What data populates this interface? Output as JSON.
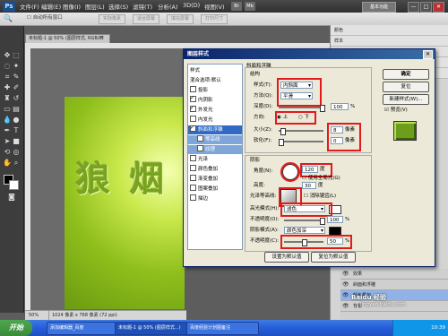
{
  "app": {
    "logo": "Ps",
    "workspace_button": "基本功能",
    "min": "—",
    "max": "□",
    "close": "✕"
  },
  "menu": [
    "文件(F)",
    "编辑(E)",
    "图像(I)",
    "图层(L)",
    "选择(S)",
    "滤镜(T)",
    "分析(A)",
    "3D(D)",
    "视图(V)"
  ],
  "menu_badges": [
    "Br",
    "Mb"
  ],
  "zoom_select": "50%",
  "options": {
    "checkbox_label": "自动所有窗口",
    "btn1": "实际像素",
    "btn2": "适合屏幕",
    "btn3": "填充屏幕",
    "btn4": "打印尺寸"
  },
  "doc_tab": {
    "title": "未标题-1 @ 50% (图层样式, RGB/8)",
    "close": "×"
  },
  "status": {
    "zoom": "50%",
    "info": "1024 像素 x 768 像素 (72 ppi)"
  },
  "canvas_text": [
    "狼",
    "烟"
  ],
  "taskbar": {
    "start": "开始",
    "tasks": [
      "添加编辑器_百度",
      "未标题-1 @ 50% (图层样式...)",
      "百度经验计划图备注"
    ],
    "tray_time": "10:39"
  },
  "watermark": {
    "line1": "Baidu 经验",
    "line2": "jingyan.baidu.com"
  },
  "right_panel": {
    "rows": [
      "颜色",
      "样本",
      "调整",
      "蒙版",
      "样式"
    ],
    "layers": [
      {
        "name": "效果",
        "selected": false
      },
      {
        "name": "斜面和浮雕",
        "selected": false
      },
      {
        "name": "颜色叠加",
        "selected": true
      },
      {
        "name": "背景",
        "selected": false
      }
    ]
  },
  "dialog": {
    "title": "图层样式",
    "close": "✕",
    "style_list": [
      {
        "label": "样式",
        "checkbox": false,
        "checked": false,
        "state": "header"
      },
      {
        "label": "混合选项:默认",
        "checkbox": false,
        "checked": false,
        "state": "normal"
      },
      {
        "label": "投影",
        "checkbox": true,
        "checked": false,
        "state": "normal"
      },
      {
        "label": "内阴影",
        "checkbox": true,
        "checked": true,
        "state": "normal"
      },
      {
        "label": "外发光",
        "checkbox": true,
        "checked": true,
        "state": "normal"
      },
      {
        "label": "内发光",
        "checkbox": true,
        "checked": false,
        "state": "normal"
      },
      {
        "label": "斜面和浮雕",
        "checkbox": true,
        "checked": true,
        "state": "selected"
      },
      {
        "label": "等高线",
        "checkbox": true,
        "checked": false,
        "state": "sub"
      },
      {
        "label": "纹理",
        "checkbox": true,
        "checked": false,
        "state": "sub"
      },
      {
        "label": "光泽",
        "checkbox": true,
        "checked": false,
        "state": "normal"
      },
      {
        "label": "颜色叠加",
        "checkbox": true,
        "checked": false,
        "state": "normal"
      },
      {
        "label": "渐变叠加",
        "checkbox": true,
        "checked": false,
        "state": "normal"
      },
      {
        "label": "图案叠加",
        "checkbox": true,
        "checked": false,
        "state": "normal"
      },
      {
        "label": "描边",
        "checkbox": true,
        "checked": false,
        "state": "normal"
      }
    ],
    "bevel": {
      "section_title": "斜面和浮雕",
      "structure_title": "结构",
      "style_label": "样式(T):",
      "style_value": "内斜面",
      "method_label": "方法(Q):",
      "method_value": "平滑",
      "depth_label": "深度(D):",
      "depth_value": "100",
      "depth_unit": "%",
      "direction_label": "方向:",
      "dir_up": "上",
      "dir_down": "下",
      "size_label": "大小(Z):",
      "size_value": "8",
      "size_unit": "像素",
      "soften_label": "软化(F):",
      "soften_value": "0",
      "soften_unit": "像素"
    },
    "shading": {
      "title": "阴影",
      "angle_label": "角度(N):",
      "angle_value": "120",
      "angle_unit": "度",
      "global_light": "使用全局光(G)",
      "altitude_label": "高度:",
      "altitude_value": "30",
      "altitude_unit": "度",
      "gloss_label": "光泽等高线:",
      "antialias": "消除锯齿(L)",
      "highlight_label": "高光模式(H):",
      "highlight_mode": "滤色",
      "opacity1_label": "不透明度(O):",
      "opacity1_value": "100",
      "opacity1_unit": "%",
      "shadow_label": "阴影模式(A):",
      "shadow_mode": "颜色加深",
      "opacity2_label": "不透明度(C):",
      "opacity2_value": "50",
      "opacity2_unit": "%"
    },
    "buttons": {
      "ok": "确定",
      "reset": "复位",
      "new_style": "新建样式(W)...",
      "preview": "预览(V)",
      "set_default": "设置为默认值",
      "reset_default": "复位为默认值"
    }
  },
  "colors": {
    "highlight_red": "#e21a1a",
    "dialog_title": "#0a246a",
    "selection": "#316ac5",
    "canvas_green": "#8fbf1c"
  }
}
